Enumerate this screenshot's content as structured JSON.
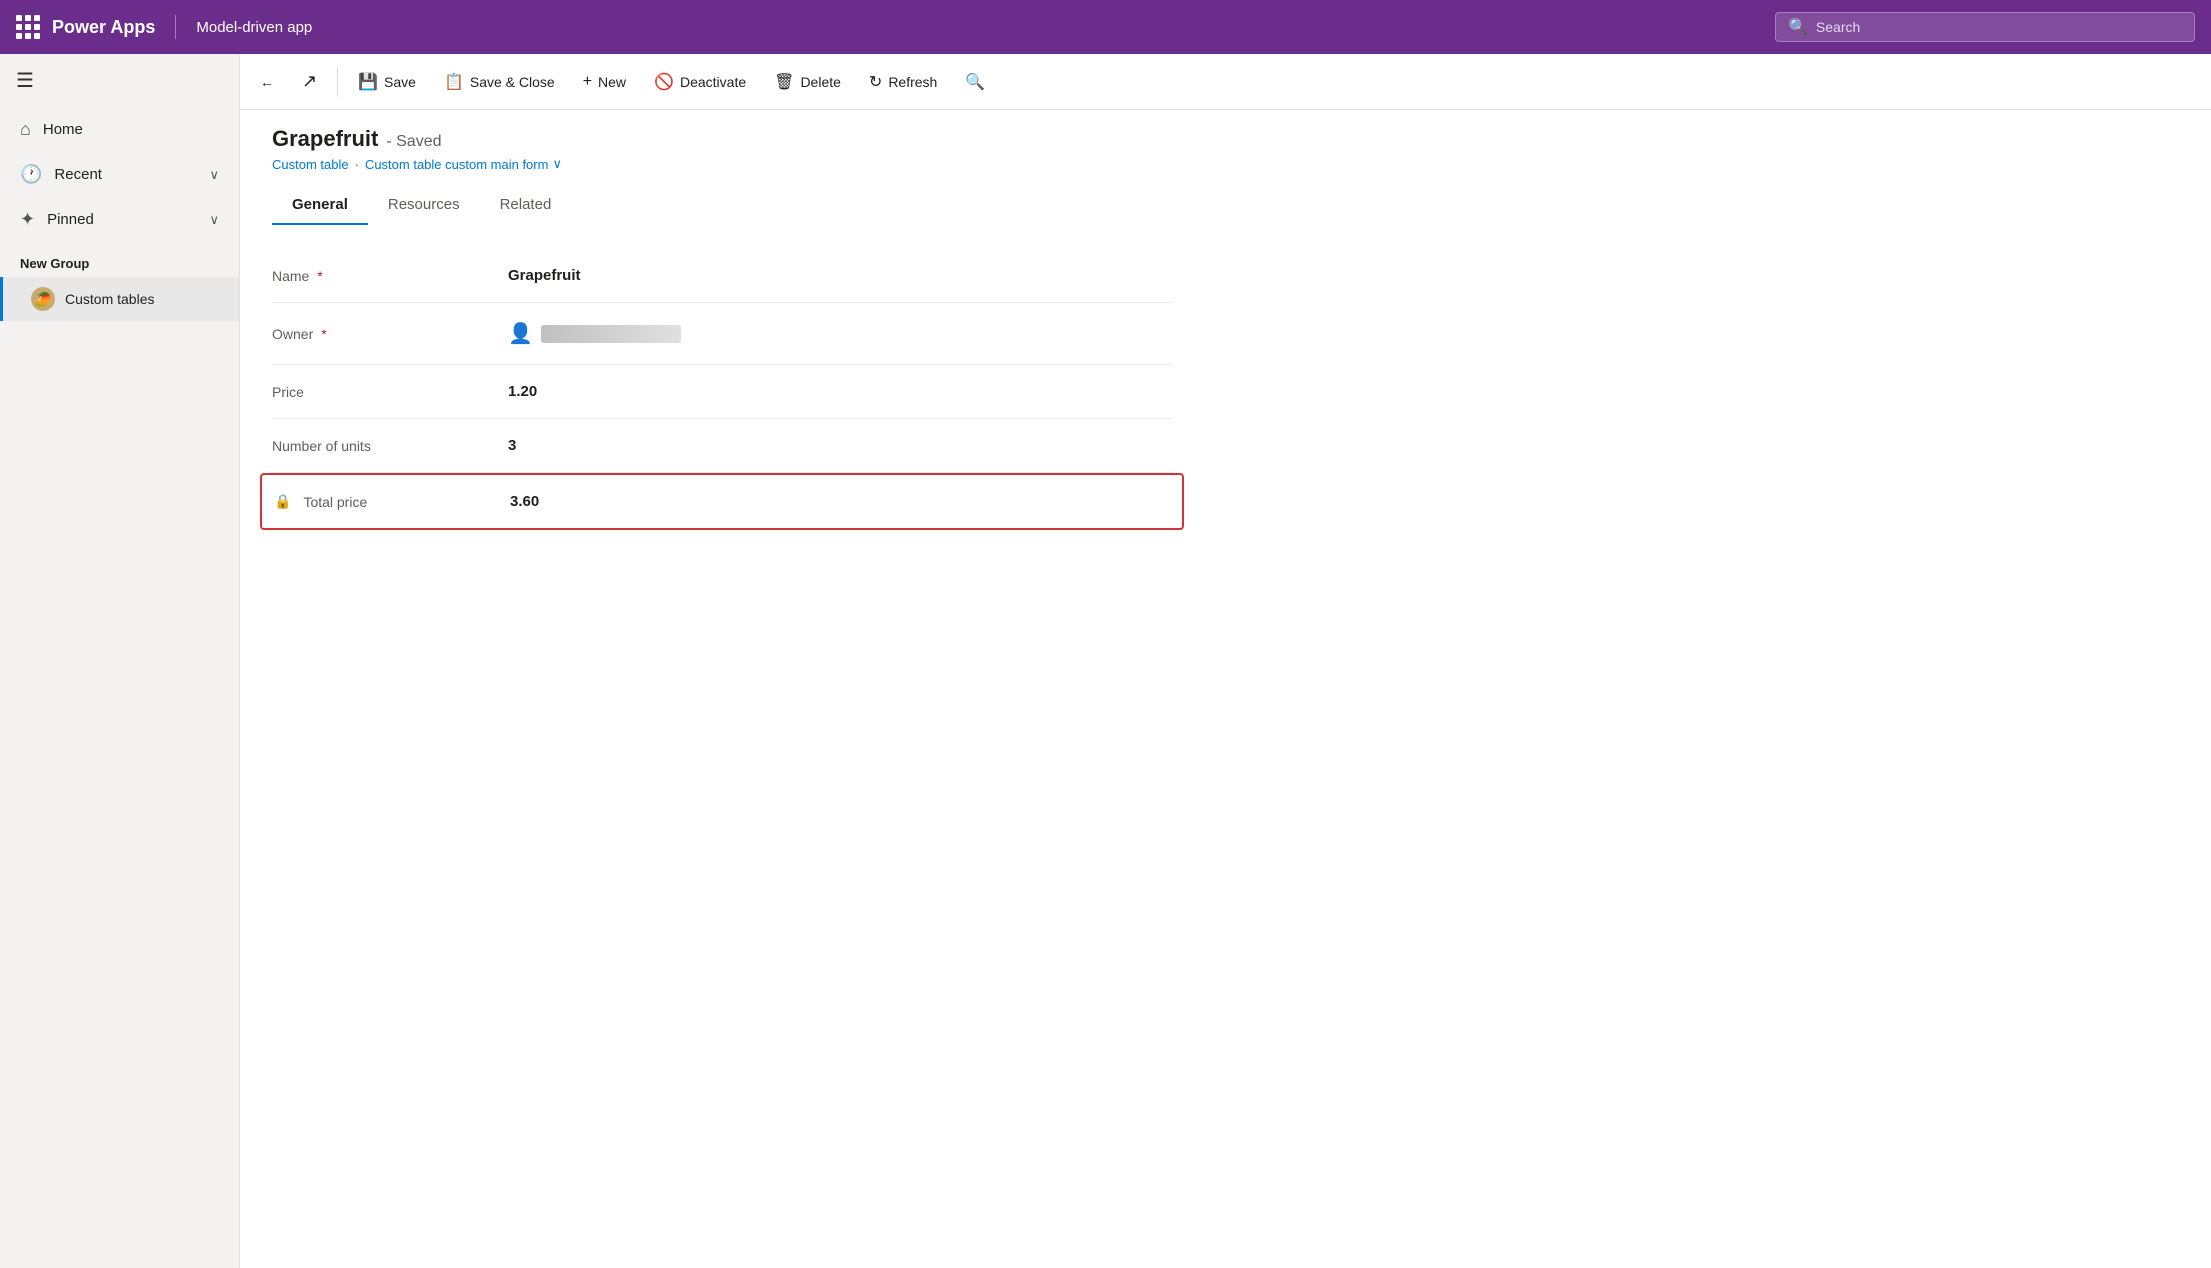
{
  "topbar": {
    "logo": "Power Apps",
    "app_name": "Model-driven app",
    "search_placeholder": "Search"
  },
  "sidebar": {
    "nav_items": [
      {
        "id": "home",
        "label": "Home",
        "icon": "⌂"
      },
      {
        "id": "recent",
        "label": "Recent",
        "icon": "🕐",
        "has_chevron": true
      },
      {
        "id": "pinned",
        "label": "Pinned",
        "icon": "✦",
        "has_chevron": true
      }
    ],
    "group_label": "New Group",
    "sub_items": [
      {
        "id": "custom-tables",
        "label": "Custom tables",
        "icon": "🥭",
        "active": true
      }
    ]
  },
  "toolbar": {
    "back_label": "←",
    "external_label": "↗",
    "save_label": "Save",
    "save_close_label": "Save & Close",
    "new_label": "New",
    "deactivate_label": "Deactivate",
    "delete_label": "Delete",
    "refresh_label": "Refresh",
    "search_label": "🔍"
  },
  "record": {
    "title": "Grapefruit",
    "status": "- Saved",
    "breadcrumb_table": "Custom table",
    "breadcrumb_form": "Custom table custom main form"
  },
  "tabs": [
    {
      "id": "general",
      "label": "General",
      "active": true
    },
    {
      "id": "resources",
      "label": "Resources",
      "active": false
    },
    {
      "id": "related",
      "label": "Related",
      "active": false
    }
  ],
  "form": {
    "fields": [
      {
        "id": "name",
        "label": "Name",
        "required": true,
        "value": "Grapefruit",
        "type": "text"
      },
      {
        "id": "owner",
        "label": "Owner",
        "required": true,
        "value": "owner_blurred",
        "type": "owner"
      },
      {
        "id": "price",
        "label": "Price",
        "required": false,
        "value": "1.20",
        "type": "text"
      },
      {
        "id": "units",
        "label": "Number of units",
        "required": false,
        "value": "3",
        "type": "text"
      },
      {
        "id": "total_price",
        "label": "Total price",
        "required": false,
        "value": "3.60",
        "type": "locked",
        "highlighted": true
      }
    ]
  }
}
